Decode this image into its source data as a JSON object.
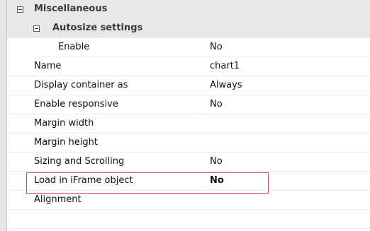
{
  "categories": {
    "misc": "Miscellaneous",
    "autosize": "Autosize settings"
  },
  "rows": [
    {
      "name": "Enable",
      "value": "No"
    },
    {
      "name": "Name",
      "value": "chart1"
    },
    {
      "name": "Display container as",
      "value": "Always"
    },
    {
      "name": "Enable responsive",
      "value": "No"
    },
    {
      "name": "Margin width",
      "value": ""
    },
    {
      "name": "Margin height",
      "value": ""
    },
    {
      "name": "Sizing and Scrolling",
      "value": "No"
    },
    {
      "name": "Load in iFrame object",
      "value": "No"
    },
    {
      "name": "Alignment",
      "value": ""
    }
  ],
  "colors": {
    "highlight": "#d94b4b"
  }
}
